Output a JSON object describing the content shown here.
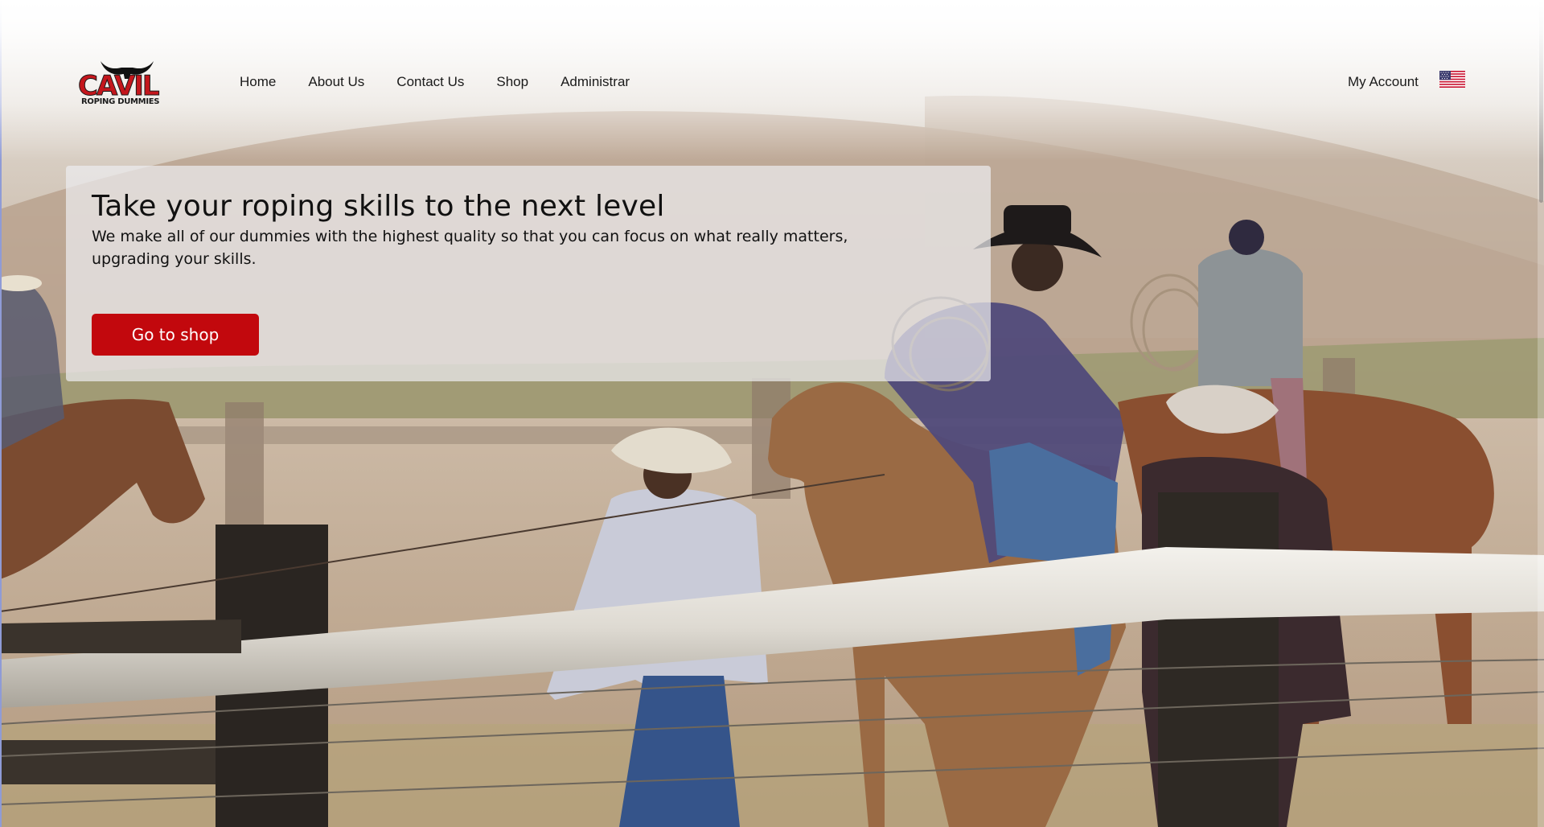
{
  "brand": {
    "logo_word": "CAVIL",
    "logo_subtitle": "ROPING DUMMIES"
  },
  "nav": {
    "items": [
      {
        "label": "Home"
      },
      {
        "label": "About Us"
      },
      {
        "label": "Contact Us"
      },
      {
        "label": "Shop"
      },
      {
        "label": "Administrar"
      }
    ],
    "account_label": "My Account",
    "language_flag": "us-flag-icon"
  },
  "hero": {
    "title": "Take your roping skills to the next level",
    "text": "We make all of our dummies with the highest quality so that you can focus on what really matters, upgrading your skills.",
    "cta_label": "Go to shop"
  },
  "colors": {
    "accent": "#c2080d",
    "logo_red": "#c4161c",
    "text": "#1a1a1a"
  }
}
